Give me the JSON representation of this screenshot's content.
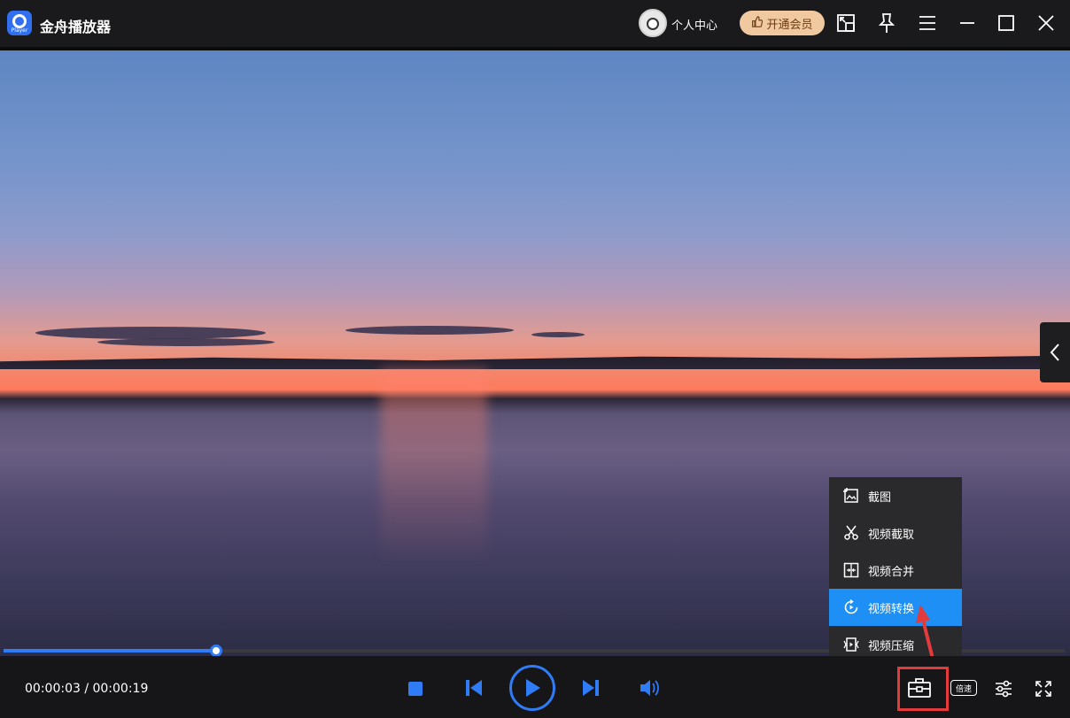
{
  "app": {
    "title": "金舟播放器",
    "logo_text": "Player"
  },
  "header": {
    "user_center": "个人中心",
    "vip_button": "开通会员"
  },
  "playback": {
    "current_time": "00:00:03",
    "total_time": "00:00:19",
    "time_display": "00:00:03 / 00:00:19",
    "progress": 0.2
  },
  "tools_menu": {
    "items": [
      {
        "label": "截图",
        "icon": "screenshot-icon"
      },
      {
        "label": "视频截取",
        "icon": "scissors-icon"
      },
      {
        "label": "视频合并",
        "icon": "merge-icon"
      },
      {
        "label": "视频转换",
        "icon": "convert-icon"
      },
      {
        "label": "视频压缩",
        "icon": "compress-icon"
      }
    ],
    "active_index": 3
  },
  "controls": {
    "speed_label": "倍速"
  },
  "colors": {
    "accent": "#2f7cf6",
    "menu_active": "#1e8ff5",
    "highlight": "#e33b3b",
    "vip": "#f0c9a0"
  }
}
